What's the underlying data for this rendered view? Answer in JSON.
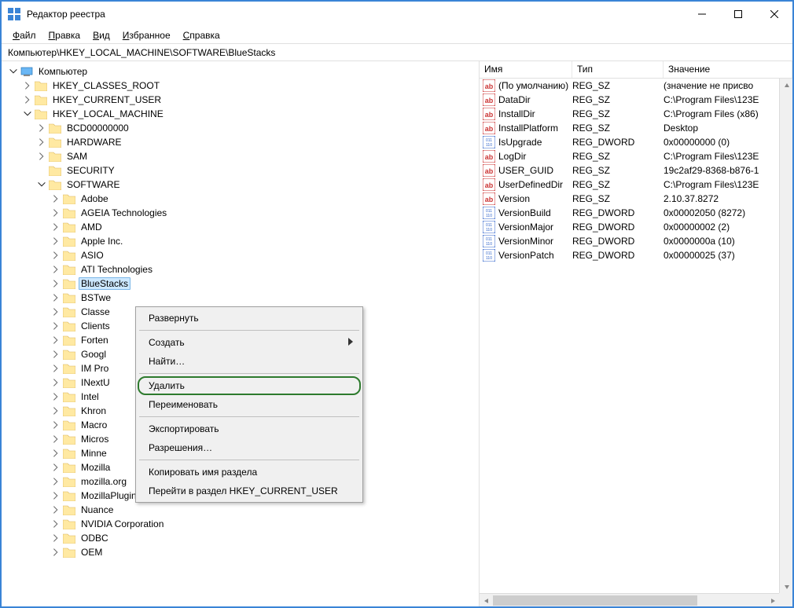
{
  "window": {
    "title": "Редактор реестра"
  },
  "menu": {
    "file": "Файл",
    "edit": "Правка",
    "view": "Вид",
    "favorites": "Избранное",
    "help": "Справка"
  },
  "address": "Компьютер\\HKEY_LOCAL_MACHINE\\SOFTWARE\\BlueStacks",
  "tree": {
    "root": "Компьютер",
    "hkcr": "HKEY_CLASSES_ROOT",
    "hkcu": "HKEY_CURRENT_USER",
    "hklm": "HKEY_LOCAL_MACHINE",
    "bcd": "BCD00000000",
    "hardware": "HARDWARE",
    "sam": "SAM",
    "security": "SECURITY",
    "software": "SOFTWARE",
    "adobe": "Adobe",
    "ageia": "AGEIA Technologies",
    "amd": "AMD",
    "apple": "Apple Inc.",
    "asio": "ASIO",
    "ati": "ATI Technologies",
    "bluestacks": "BlueStacks",
    "bstweaker": "BSTwe",
    "classes": "Classe",
    "clients": "Clients",
    "fortemedia": "Forten",
    "google": "Googl",
    "improgram": "IM Pro",
    "inext": "INextU",
    "intel": "Intel",
    "khronos": "Khron",
    "macromedia": "Macro",
    "microsoft": "Micros",
    "minnetonka": "Minne",
    "mozilla": "Mozilla",
    "mozillaorg": "mozilla.org",
    "mozillaplugins": "MozillaPlugins",
    "nuance": "Nuance",
    "nvidia": "NVIDIA Corporation",
    "odbc": "ODBC",
    "oem": "OEM"
  },
  "columns": {
    "name": "Имя",
    "type": "Тип",
    "value": "Значение"
  },
  "values": [
    {
      "icon": "sz",
      "name": "(По умолчанию)",
      "type": "REG_SZ",
      "value": "(значение не присво"
    },
    {
      "icon": "sz",
      "name": "DataDir",
      "type": "REG_SZ",
      "value": "C:\\Program Files\\123E"
    },
    {
      "icon": "sz",
      "name": "InstallDir",
      "type": "REG_SZ",
      "value": "C:\\Program Files (x86)"
    },
    {
      "icon": "sz",
      "name": "InstallPlatform",
      "type": "REG_SZ",
      "value": "Desktop"
    },
    {
      "icon": "dw",
      "name": "IsUpgrade",
      "type": "REG_DWORD",
      "value": "0x00000000 (0)"
    },
    {
      "icon": "sz",
      "name": "LogDir",
      "type": "REG_SZ",
      "value": "C:\\Program Files\\123E"
    },
    {
      "icon": "sz",
      "name": "USER_GUID",
      "type": "REG_SZ",
      "value": "19c2af29-8368-b876-1"
    },
    {
      "icon": "sz",
      "name": "UserDefinedDir",
      "type": "REG_SZ",
      "value": "C:\\Program Files\\123E"
    },
    {
      "icon": "sz",
      "name": "Version",
      "type": "REG_SZ",
      "value": "2.10.37.8272"
    },
    {
      "icon": "dw",
      "name": "VersionBuild",
      "type": "REG_DWORD",
      "value": "0x00002050 (8272)"
    },
    {
      "icon": "dw",
      "name": "VersionMajor",
      "type": "REG_DWORD",
      "value": "0x00000002 (2)"
    },
    {
      "icon": "dw",
      "name": "VersionMinor",
      "type": "REG_DWORD",
      "value": "0x0000000a (10)"
    },
    {
      "icon": "dw",
      "name": "VersionPatch",
      "type": "REG_DWORD",
      "value": "0x00000025 (37)"
    }
  ],
  "context": {
    "expand": "Развернуть",
    "new": "Создать",
    "find": "Найти…",
    "delete": "Удалить",
    "rename": "Переименовать",
    "export": "Экспортировать",
    "permissions": "Разрешения…",
    "copyKeyName": "Копировать имя раздела",
    "gotoHkcu": "Перейти в раздел HKEY_CURRENT_USER"
  }
}
